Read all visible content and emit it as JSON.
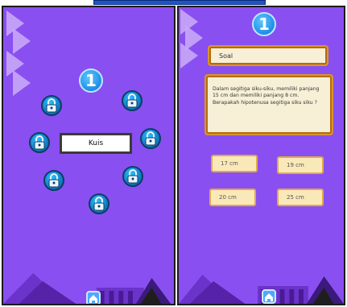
{
  "screen_left": {
    "level_number": "1",
    "quiz_label": "Kuis",
    "lock_icon": "padlock-icon",
    "home_icon": "home-icon"
  },
  "screen_right": {
    "level_number": "1",
    "question_title": "Soal",
    "question_text": "Dalam segitiga siku-siku, memiliki panjang 15 cm dan memiliki panjang 8 cm. Berapakah hipotenusa segitiga siku siku ?",
    "answers": [
      "17 cm",
      "19 cm",
      "20 cm",
      "25 cm"
    ],
    "home_icon": "home-icon"
  },
  "colors": {
    "panel_bg": "#8a4ff0",
    "badge": "#1f8de8",
    "card_bg": "#f8f0d6",
    "card_border": "#d7972a",
    "answer_bg": "#fae9b8"
  }
}
